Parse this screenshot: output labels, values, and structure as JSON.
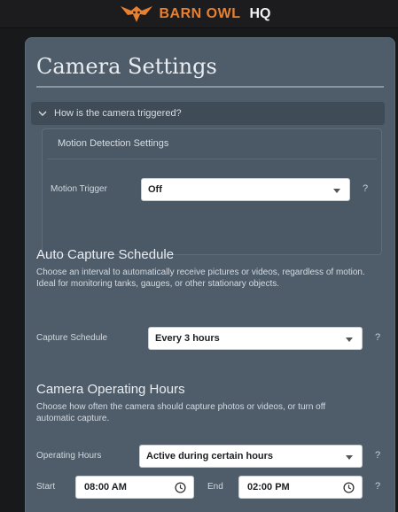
{
  "brand": {
    "name": "BARN OWL",
    "suffix": "HQ"
  },
  "page": {
    "title": "Camera Settings"
  },
  "accordion": {
    "label": "How is the camera triggered?"
  },
  "motion": {
    "heading": "Motion Detection Settings",
    "trigger_label": "Motion Trigger",
    "trigger_value": "Off",
    "help": "?"
  },
  "auto_capture": {
    "title": "Auto Capture Schedule",
    "description": "Choose an interval to automatically receive pictures or videos, regardless of motion. Ideal for monitoring tanks, gauges, or other stationary objects.",
    "schedule_label": "Capture Schedule",
    "schedule_value": "Every 3 hours",
    "help": "?"
  },
  "operating_hours": {
    "title": "Camera Operating Hours",
    "description": "Choose how often the camera should capture photos or videos, or turn off automatic capture.",
    "hours_label": "Operating Hours",
    "hours_value": "Active during certain hours",
    "help": "?",
    "start_label": "Start",
    "start_value": "08:00 AM",
    "end_label": "End",
    "end_value": "02:00 PM",
    "time_help": "?"
  },
  "colors": {
    "brand_orange": "#e8812f",
    "card_bg": "#4f5d6b",
    "page_bg": "#18191b"
  },
  "icons": [
    "owl-logo-icon",
    "chevron-down-icon",
    "caret-down-icon",
    "clock-icon"
  ]
}
